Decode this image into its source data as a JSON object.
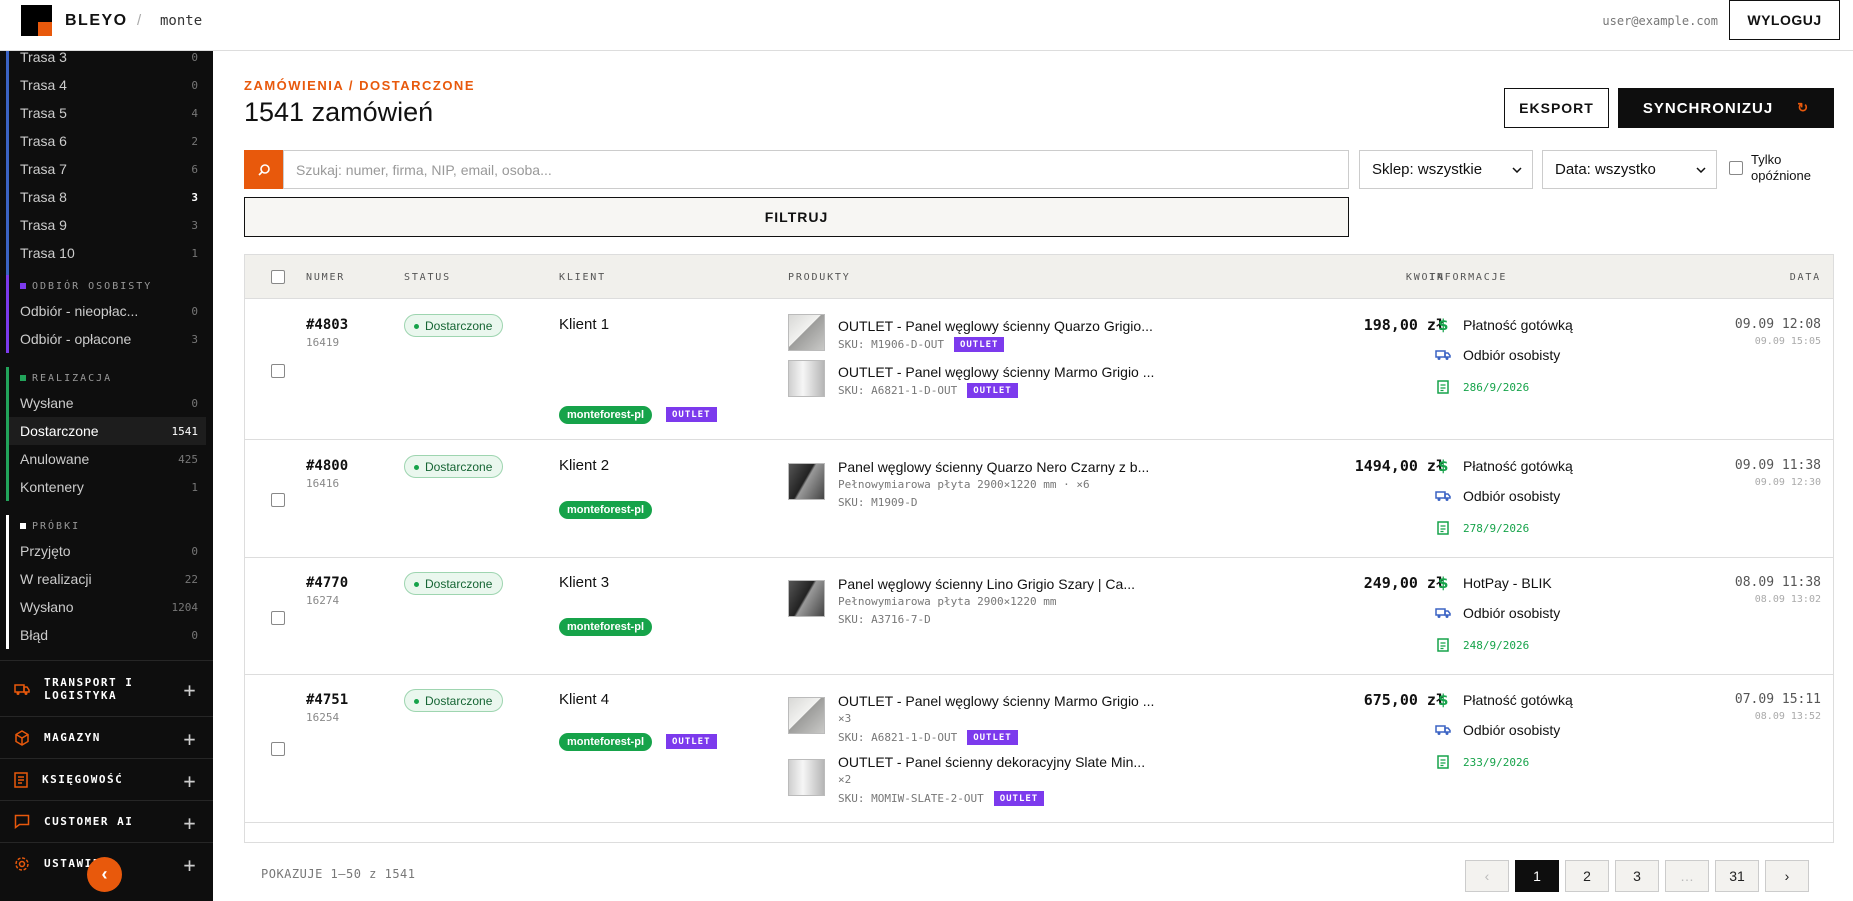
{
  "topbar": {
    "brand": "BLEYO",
    "separator": "/",
    "workspace": "monte",
    "user_email": "user@example.com",
    "logout_label": "WYLOGUJ"
  },
  "sidebar": {
    "routes": [
      {
        "label": "Trasa 3",
        "count": "0"
      },
      {
        "label": "Trasa 4",
        "count": "0"
      },
      {
        "label": "Trasa 5",
        "count": "4"
      },
      {
        "label": "Trasa 6",
        "count": "2"
      },
      {
        "label": "Trasa 7",
        "count": "6"
      },
      {
        "label": "Trasa 8",
        "count": "3"
      },
      {
        "label": "Trasa 9",
        "count": "3"
      },
      {
        "label": "Trasa 10",
        "count": "1"
      }
    ],
    "pickup": {
      "title": "ODBIÓR OSOBISTY",
      "items": [
        {
          "label": "Odbiór - nieopłac...",
          "count": "0"
        },
        {
          "label": "Odbiór - opłacone",
          "count": "3"
        }
      ]
    },
    "realization": {
      "title": "REALIZACJA",
      "items": [
        {
          "label": "Wysłane",
          "count": "0"
        },
        {
          "label": "Dostarczone",
          "count": "1541"
        },
        {
          "label": "Anulowane",
          "count": "425"
        },
        {
          "label": "Kontenery",
          "count": "1"
        }
      ]
    },
    "samples": {
      "title": "PRÓBKI",
      "items": [
        {
          "label": "Przyjęto",
          "count": "0"
        },
        {
          "label": "W realizacji",
          "count": "22"
        },
        {
          "label": "Wysłano",
          "count": "1204"
        },
        {
          "label": "Błąd",
          "count": "0"
        }
      ]
    },
    "nav": [
      {
        "label": "TRANSPORT I",
        "label2": "LOGISTYKA"
      },
      {
        "label": "MAGAZYN"
      },
      {
        "label": "KSIĘGOWOŚĆ"
      },
      {
        "label": "CUSTOMER AI"
      },
      {
        "label": "USTAWIE"
      }
    ],
    "colors": {
      "routes": "#3b63c4",
      "pickup": "#7c3aed",
      "realization": "#22a35a",
      "samples": "#ffffff",
      "accent": "#e8590c"
    }
  },
  "main": {
    "breadcrumb": "ZAMÓWIENIA / DOSTARCZONE",
    "title": "1541 zamówień",
    "export_label": "EKSPORT",
    "sync_label": "SYNCHRONIZUJ",
    "sync_icon": "↻",
    "search_placeholder": "Szukaj: numer, firma, NIP, email, osoba...",
    "shop_select": "Sklep: wszystkie",
    "date_select": "Data: wszystko",
    "late_label": "Tylko opóźnione",
    "filter_label": "FILTRUJ"
  },
  "table": {
    "headers": {
      "number": "NUMER",
      "status": "STATUS",
      "client": "KLIENT",
      "products": "PRODUKTY",
      "amount": "KWOTA",
      "info": "INFORMACJE",
      "date": "DATA"
    },
    "rows": [
      {
        "number": "#4803",
        "sub": "16419",
        "status": "Dostarczone",
        "client": "Klient 1",
        "shop": "monteforest-pl",
        "outlet": "OUTLET",
        "products": [
          {
            "name": "OUTLET - Panel węglowy ścienny Quarzo Grigio...",
            "sub": "SKU: M1906-D-OUT",
            "outlet": "OUTLET"
          },
          {
            "name": "OUTLET - Panel węglowy ścienny Marmo Grigio ...",
            "sub": "SKU: A6821-1-D-OUT",
            "outlet": "OUTLET"
          }
        ],
        "amount": "198,00 zł",
        "payment": "Płatność gotówką",
        "delivery": "Odbiór osobisty",
        "invoice": "286/9/2026",
        "date": "09.09 12:08",
        "date2": "09.09 15:05"
      },
      {
        "number": "#4800",
        "sub": "16416",
        "status": "Dostarczone",
        "client": "Klient 2",
        "shop": "monteforest-pl",
        "products": [
          {
            "name": "Panel węglowy ścienny Quarzo Nero Czarny z b...",
            "sub": "Pełnowymiarowa płyta 2900×1220 mm · ×6",
            "sub2": "SKU: M1909-D"
          }
        ],
        "amount": "1494,00 zł",
        "payment": "Płatność gotówką",
        "delivery": "Odbiór osobisty",
        "invoice": "278/9/2026",
        "date": "09.09 11:38",
        "date2": "09.09 12:30"
      },
      {
        "number": "#4770",
        "sub": "16274",
        "status": "Dostarczone",
        "client": "Klient 3",
        "shop": "monteforest-pl",
        "products": [
          {
            "name": "Panel węglowy ścienny Lino Grigio Szary | Ca...",
            "sub": "Pełnowymiarowa płyta 2900×1220 mm",
            "sub2": "SKU: A3716-7-D"
          }
        ],
        "amount": "249,00 zł",
        "payment": "HotPay - BLIK",
        "delivery": "Odbiór osobisty",
        "invoice": "248/9/2026",
        "date": "08.09 11:38",
        "date2": "08.09 13:02"
      },
      {
        "number": "#4751",
        "sub": "16254",
        "status": "Dostarczone",
        "client": "Klient 4",
        "shop": "monteforest-pl",
        "outlet": "OUTLET",
        "products": [
          {
            "name": "OUTLET - Panel węglowy ścienny Marmo Grigio ...",
            "sub": "×3",
            "sub2": "SKU: A6821-1-D-OUT",
            "outlet": "OUTLET"
          },
          {
            "name": "OUTLET - Panel ścienny dekoracyjny Slate Min...",
            "sub": "×2",
            "sub2": "SKU: MOMIW-SLATE-2-OUT",
            "outlet": "OUTLET"
          }
        ],
        "amount": "675,00 zł",
        "payment": "Płatność gotówką",
        "delivery": "Odbiór osobisty",
        "invoice": "233/9/2026",
        "date": "07.09 15:11",
        "date2": "08.09 13:52"
      }
    ]
  },
  "pager": {
    "info": "POKAZUJE 1–50 z 1541",
    "prev": "‹",
    "pages": [
      "1",
      "2",
      "3",
      "…",
      "31"
    ],
    "next": "›"
  }
}
